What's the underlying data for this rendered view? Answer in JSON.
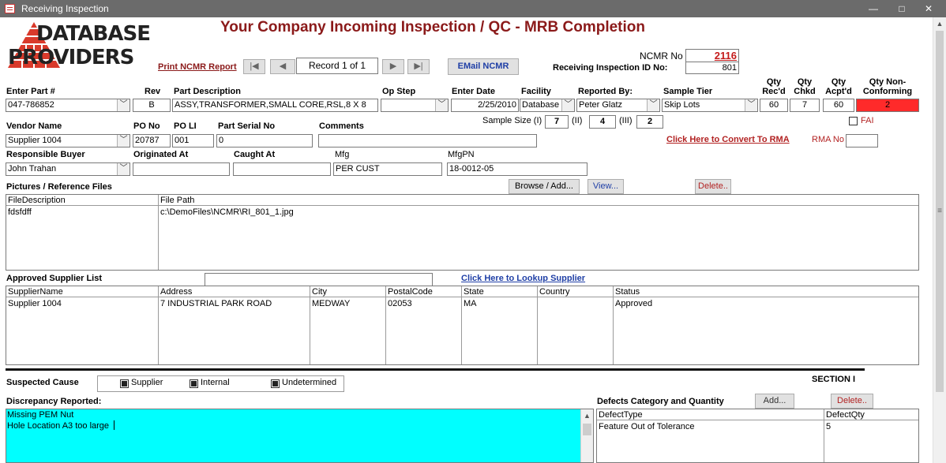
{
  "window": {
    "title": "Receiving Inspection",
    "minimize": "—",
    "maximize": "□",
    "close": "✕"
  },
  "logo": {
    "line1": "DATABASE",
    "line2": "PROVIDERS"
  },
  "header": {
    "title": "Your Company Incoming Inspection / QC - MRB Completion",
    "print_link": "Print NCMR Report"
  },
  "record_nav": {
    "first": "|◀",
    "prev": "◀",
    "record": "Record 1 of 1",
    "next": "▶",
    "last": "▶|"
  },
  "email_button": "EMail NCMR",
  "ncmr": {
    "label": "NCMR No",
    "value": "2116",
    "ri_label": "Receiving Inspection ID No:",
    "ri_value": "801"
  },
  "labels": {
    "part": "Enter Part #",
    "rev": "Rev",
    "desc": "Part Description",
    "opstep": "Op Step",
    "date": "Enter Date",
    "facility": "Facility",
    "reported": "Reported By:",
    "tier": "Sample Tier",
    "qty_recd": "Qty Rec'd",
    "qty_chkd": "Qty Chkd",
    "qty_acpt": "Qty Acpt'd",
    "qty_nc": "Qty Non-Conforming",
    "vendor": "Vendor Name",
    "po": "PO No",
    "poli": "PO LI",
    "serial": "Part Serial No",
    "comments": "Comments",
    "sample_size": "Sample Size (I)",
    "ii": "(II)",
    "iii": "(III)",
    "fai": "FAI",
    "rma_link": "Click Here to Convert To RMA",
    "rma_no": "RMA No",
    "buyer": "Responsible Buyer",
    "orig": "Originated At",
    "caught": "Caught At",
    "mfg": "Mfg",
    "mfgpn": "MfgPN",
    "pictures": "Pictures / Reference Files",
    "approved": "Approved Supplier List",
    "lookup": "Click Here to Lookup Supplier",
    "suspected": "Suspected Cause",
    "section": "SECTION I",
    "discrepancy": "Discrepancy Reported:",
    "defects": "Defects Category and Quantity"
  },
  "fields": {
    "part": "047-786852",
    "rev": "B",
    "desc": "ASSY,TRANSFORMER,SMALL CORE,RSL,8 X 8",
    "opstep": "",
    "date": "2/25/2010",
    "facility": "Database",
    "reported": "Peter Glatz",
    "tier": "Skip Lots",
    "qty_recd": "60",
    "qty_chkd": "7",
    "qty_acpt": "60",
    "qty_nc": "2",
    "vendor": "Supplier 1004",
    "po": "20787",
    "poli": "001",
    "serial": "0",
    "comments": "",
    "ss1": "7",
    "ss2": "4",
    "ss3": "2",
    "rma_no": "",
    "buyer": "John Trahan",
    "orig": "",
    "caught": "",
    "mfg": "PER CUST",
    "mfgpn": "18-0012-05",
    "supplier_search": ""
  },
  "file_buttons": {
    "browse": "Browse / Add...",
    "view": "View...",
    "delete": "Delete.."
  },
  "files_grid": {
    "headers": [
      "FileDescription",
      "File Path"
    ],
    "rows": [
      [
        "fdsfdff",
        "c:\\DemoFiles\\NCMR\\RI_801_1.jpg"
      ]
    ]
  },
  "supplier_grid": {
    "headers": [
      "SupplierName",
      "Address",
      "City",
      "PostalCode",
      "State",
      "Country",
      "Status"
    ],
    "rows": [
      [
        "Supplier 1004",
        "7 INDUSTRIAL PARK ROAD",
        "MEDWAY",
        "02053",
        "MA",
        "",
        "Approved"
      ]
    ]
  },
  "causes": {
    "supplier": "Supplier",
    "internal": "Internal",
    "undetermined": "Undetermined"
  },
  "discrepancy_text": {
    "line1": "Missing PEM Nut",
    "line2": "Hole Location A3 too large"
  },
  "defect_buttons": {
    "add": "Add...",
    "delete": "Delete.."
  },
  "defects_grid": {
    "headers": [
      "DefectType",
      "DefectQty"
    ],
    "rows": [
      [
        "Feature Out of Tolerance",
        "5"
      ]
    ]
  },
  "colors": {
    "title_red": "#8b1a1a",
    "nc_red": "#ff2a2a",
    "discrepancy_bg": "#00ffff",
    "link_blue": "#1f3fa6"
  }
}
